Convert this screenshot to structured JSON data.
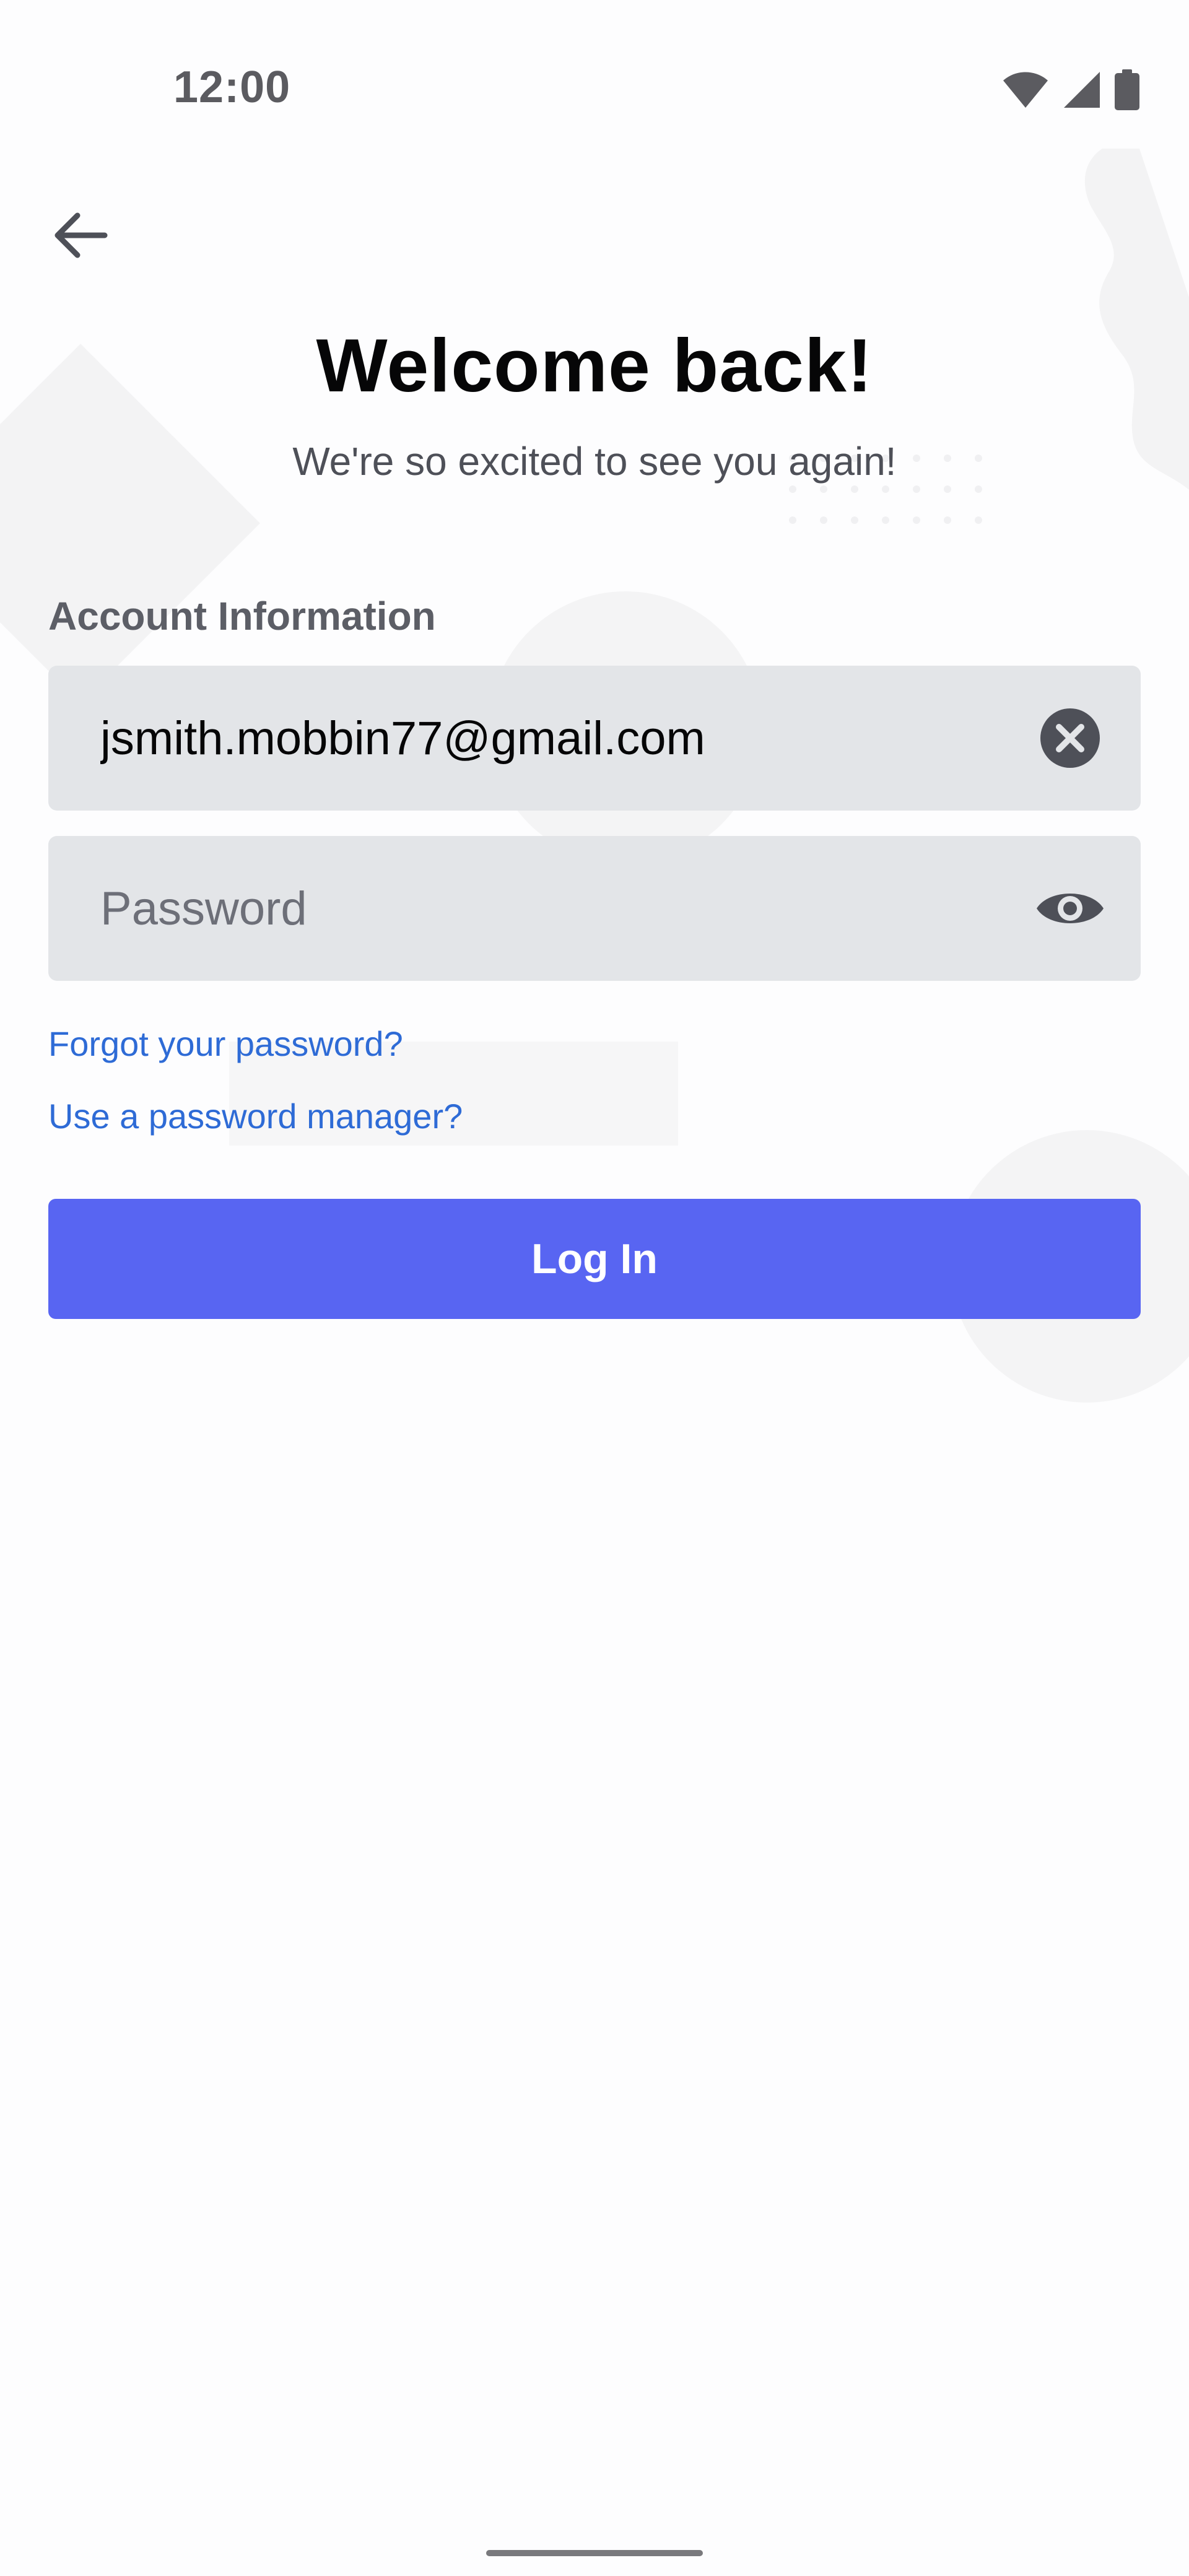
{
  "status_bar": {
    "time": "12:00",
    "icons": [
      "wifi-icon",
      "cell-signal-icon",
      "battery-icon"
    ]
  },
  "header": {
    "back_icon": "arrow-left-icon",
    "title": "Welcome back!",
    "subtitle": "We're so excited to see you again!"
  },
  "form": {
    "section_label": "Account Information",
    "email": {
      "value": "jsmith.mobbin77@gmail.com",
      "clear_icon": "clear-circle-icon"
    },
    "password": {
      "placeholder": "Password",
      "visibility_icon": "eye-icon"
    },
    "forgot_password_label": "Forgot your password?",
    "password_manager_label": "Use a password manager?",
    "login_label": "Log In"
  },
  "colors": {
    "accent": "#5865f2",
    "link": "#2e6bd6",
    "field_background": "#e3e5e8",
    "title_text": "#060607"
  }
}
